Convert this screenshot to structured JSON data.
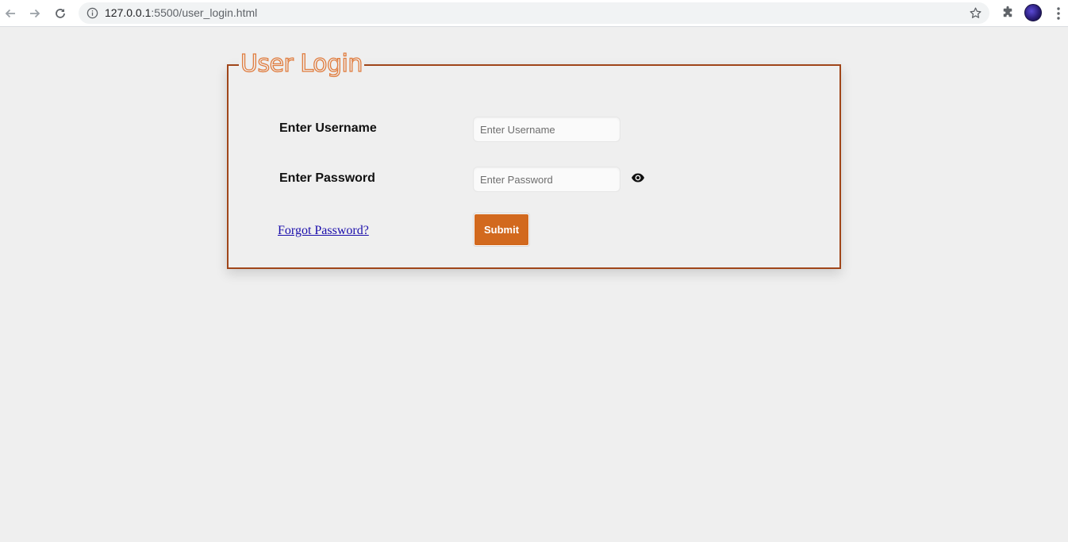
{
  "browser": {
    "url_host": "127.0.0.1",
    "url_path": ":5500/user_login.html",
    "icons": {
      "back": "arrow-left-icon",
      "forward": "arrow-right-icon",
      "reload": "reload-icon",
      "info": "info-icon",
      "bookmark": "star-icon",
      "extensions": "puzzle-icon",
      "profile": "avatar",
      "menu": "kebab-menu-icon"
    }
  },
  "form": {
    "title": "User Login",
    "username_label": "Enter Username",
    "username_placeholder": "Enter Username",
    "password_label": "Enter Password",
    "password_placeholder": "Enter Password",
    "show_password_icon": "eye-icon",
    "forgot_link": "Forgot Password?",
    "submit_label": "Submit"
  },
  "colors": {
    "border": "#a0461a",
    "title_outline": "#e07c3e",
    "submit_bg": "#d2691e",
    "link": "#1a0dab",
    "page_bg": "#efefef"
  }
}
